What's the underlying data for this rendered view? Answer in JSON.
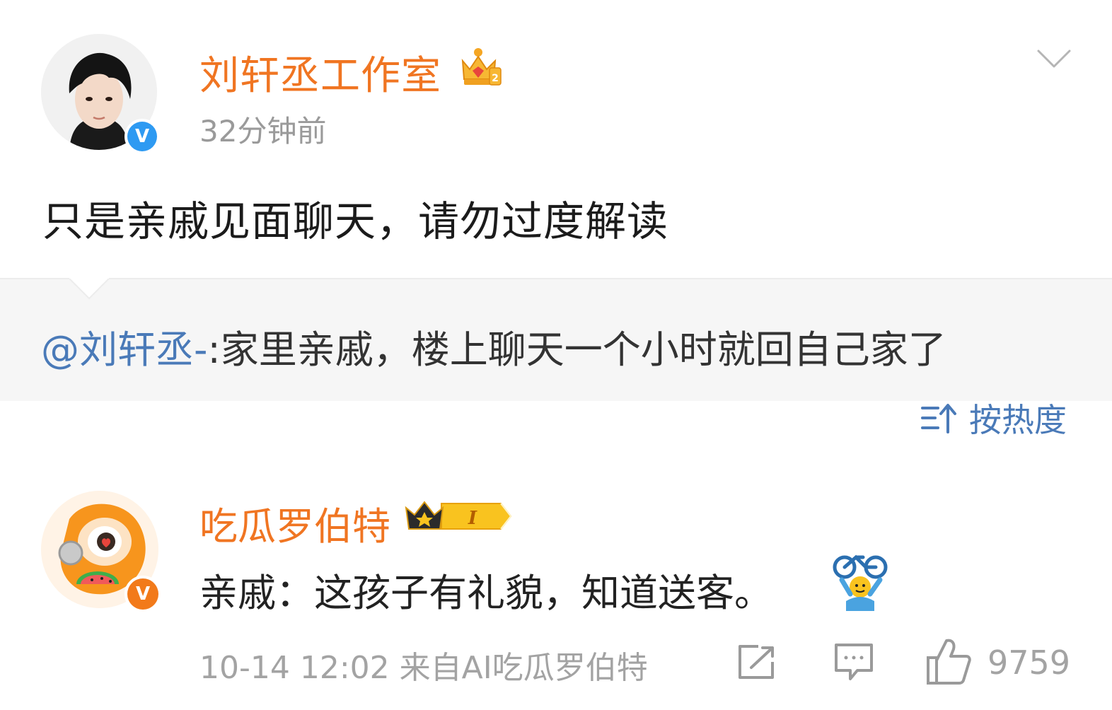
{
  "post": {
    "author": "刘轩丞工作室",
    "time": "32分钟前",
    "text": "只是亲戚见面聊天，请勿过度解读",
    "verified_badge": "V",
    "badge_color": "#2e9af2"
  },
  "quote": {
    "mention": "@刘轩丞-",
    "text": ":家里亲戚，楼上聊天一个小时就回自己家了"
  },
  "sort": {
    "label": "按热度",
    "icon": "sort-icon"
  },
  "comment": {
    "author": "吃瓜罗伯特",
    "level": "I",
    "text": "亲戚：这孩子有礼貌，知道送客。",
    "verified_badge": "V",
    "badge_color": "#f27a1a",
    "meta": "10-14 12:02 来自AI吃瓜罗伯特",
    "likes": "9759"
  },
  "colors": {
    "name": "#f07522",
    "link": "#4a7ab8",
    "meta": "#a3a3a3"
  }
}
